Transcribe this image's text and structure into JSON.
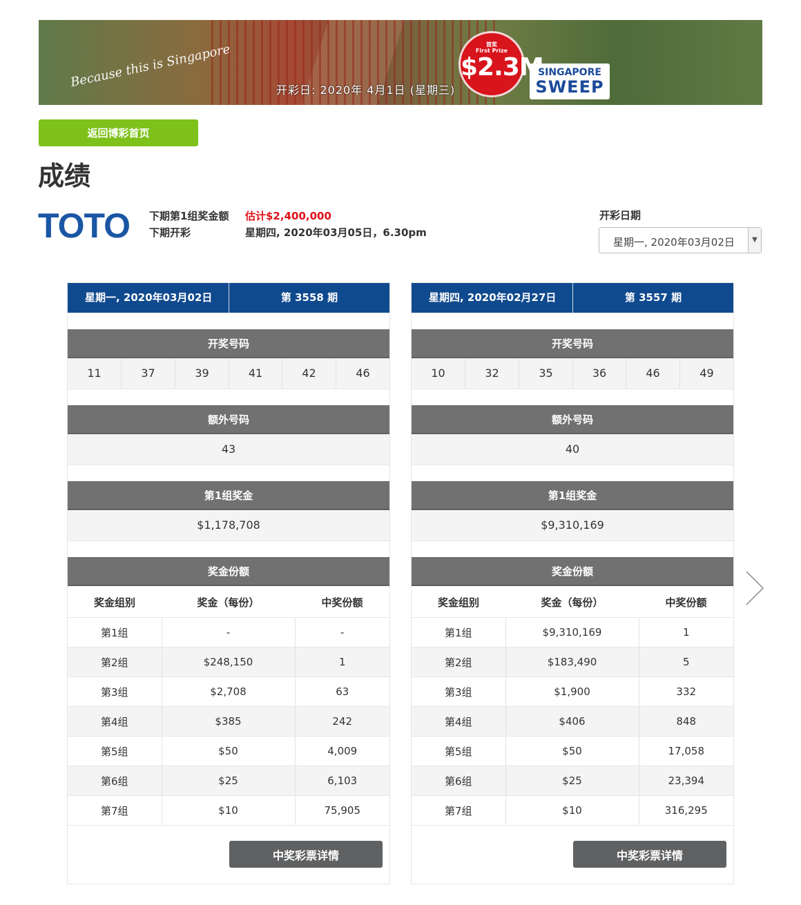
{
  "banner": {
    "tagline": "Because this is Singapore",
    "draw_date": "开彩日: 2020年 4月1日 (星期三)",
    "prize_label_cn": "首奖",
    "prize_label_en": "First Prize",
    "prize_amount": "$2.3M",
    "brand_line1": "SINGAPORE",
    "brand_line2": "SWEEP"
  },
  "back_button": "返回博彩首页",
  "page_title": "成绩",
  "logo_text": "TOTO",
  "next_info": {
    "jackpot_label": "下期第1组奖金额",
    "jackpot_value": "估计$2,400,000",
    "draw_label": "下期开彩",
    "draw_value": "星期四, 2020年03月05日，6.30pm"
  },
  "date_picker": {
    "label": "开彩日期",
    "selected": "星期一, 2020年03月02日"
  },
  "section_titles": {
    "winning": "开奖号码",
    "additional": "额外号码",
    "group1": "第1组奖金",
    "shares": "奖金份额",
    "col_group": "奖金组别",
    "col_prize": "奖金（每份）",
    "col_count": "中奖份额",
    "details_button": "中奖彩票详情"
  },
  "draws": [
    {
      "date": "星期一, 2020年03月02日",
      "draw_no": "第 3558 期",
      "numbers": [
        "11",
        "37",
        "39",
        "41",
        "42",
        "46"
      ],
      "additional": "43",
      "group1_prize": "$1,178,708",
      "shares": [
        {
          "group": "第1组",
          "prize": "-",
          "count": "-"
        },
        {
          "group": "第2组",
          "prize": "$248,150",
          "count": "1"
        },
        {
          "group": "第3组",
          "prize": "$2,708",
          "count": "63"
        },
        {
          "group": "第4组",
          "prize": "$385",
          "count": "242"
        },
        {
          "group": "第5组",
          "prize": "$50",
          "count": "4,009"
        },
        {
          "group": "第6组",
          "prize": "$25",
          "count": "6,103"
        },
        {
          "group": "第7组",
          "prize": "$10",
          "count": "75,905"
        }
      ]
    },
    {
      "date": "星期四, 2020年02月27日",
      "draw_no": "第 3557 期",
      "numbers": [
        "10",
        "32",
        "35",
        "36",
        "46",
        "49"
      ],
      "additional": "40",
      "group1_prize": "$9,310,169",
      "shares": [
        {
          "group": "第1组",
          "prize": "$9,310,169",
          "count": "1"
        },
        {
          "group": "第2组",
          "prize": "$183,490",
          "count": "5"
        },
        {
          "group": "第3组",
          "prize": "$1,900",
          "count": "332"
        },
        {
          "group": "第4组",
          "prize": "$406",
          "count": "848"
        },
        {
          "group": "第5组",
          "prize": "$50",
          "count": "17,058"
        },
        {
          "group": "第6组",
          "prize": "$25",
          "count": "23,394"
        },
        {
          "group": "第7组",
          "prize": "$10",
          "count": "316,295"
        }
      ]
    }
  ],
  "colors": {
    "header_blue": "#104a8e",
    "section_grey": "#717171",
    "back_green": "#7ec11a",
    "red": "#e0101a"
  }
}
